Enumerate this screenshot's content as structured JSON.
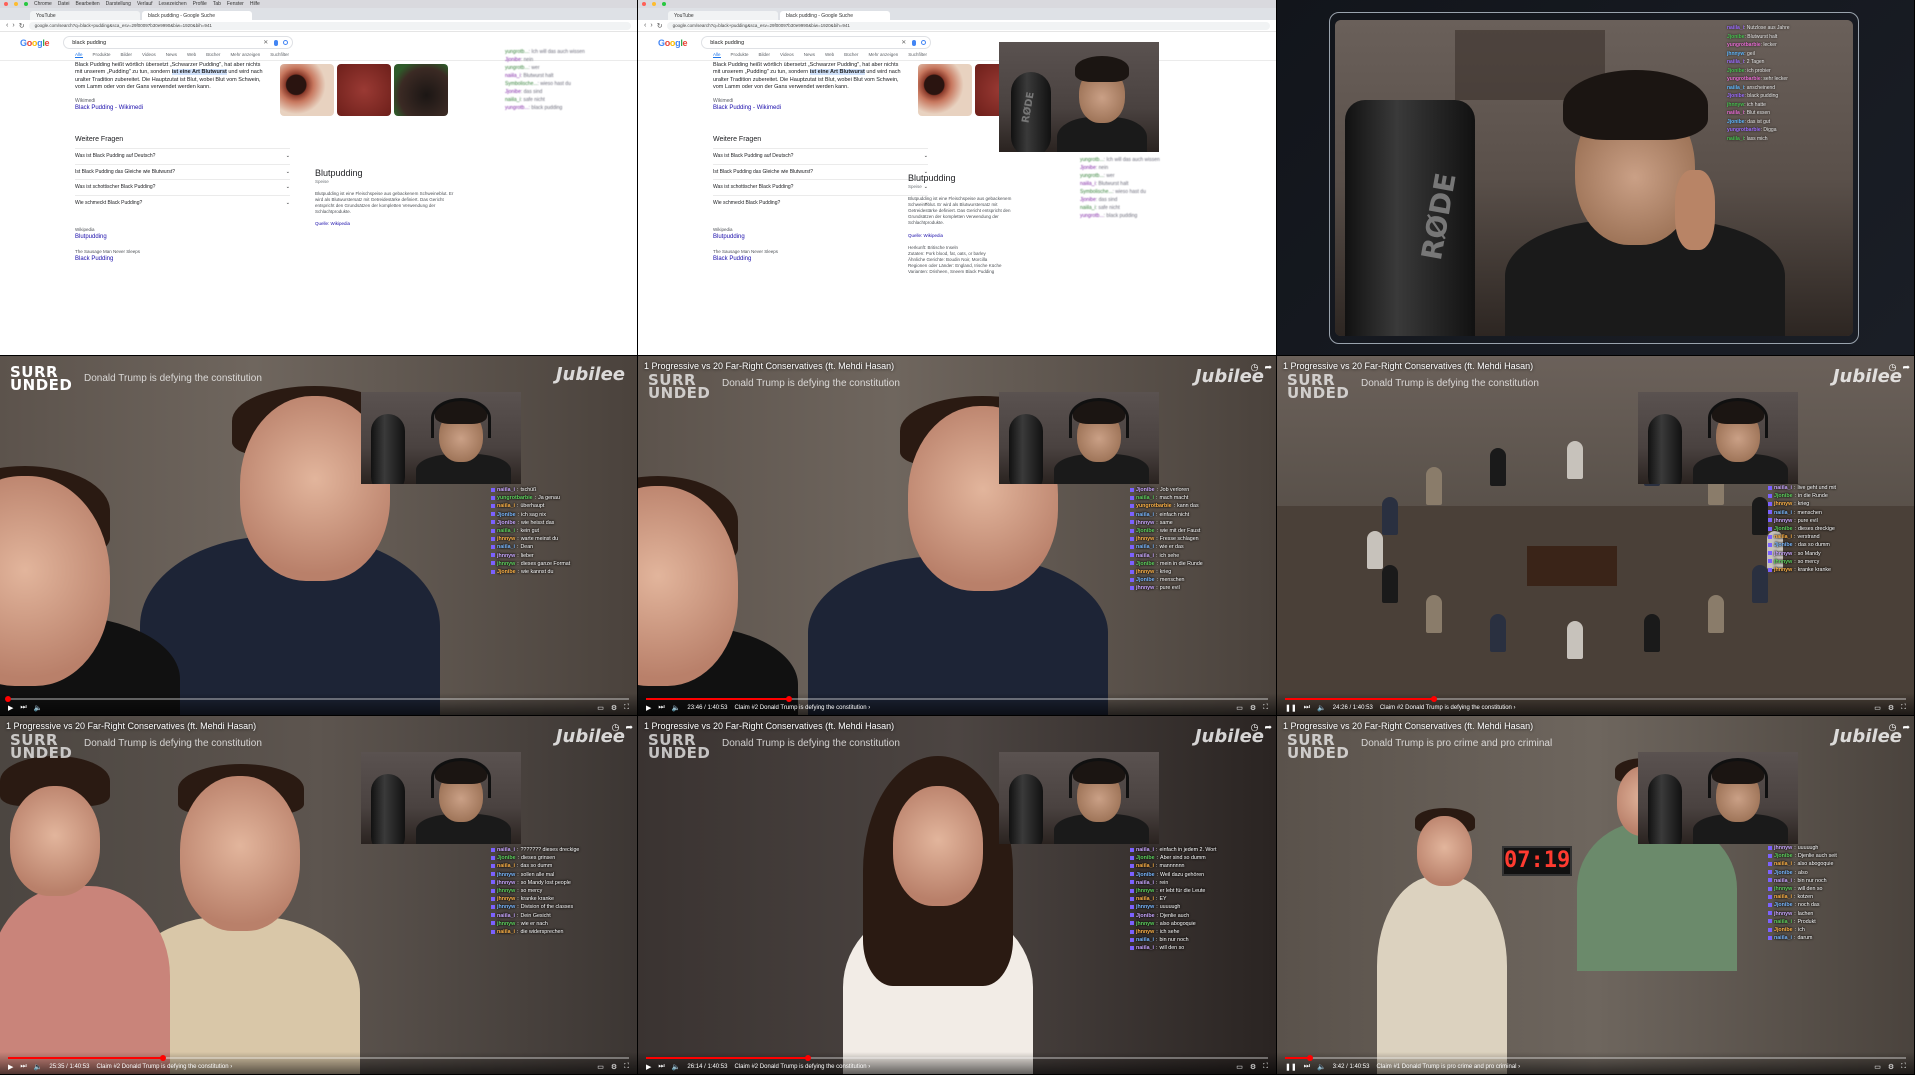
{
  "browser": {
    "mac_menu": [
      "Chrome",
      "Datei",
      "Bearbeiten",
      "Darstellung",
      "Verlauf",
      "Lesezeichen",
      "Profile",
      "Tab",
      "Fenster",
      "Hilfe"
    ],
    "tabs": [
      "YouTube",
      "black pudding - Google Suche"
    ],
    "url": "google.com/search?q=black+pudding&sca_esv=29f00097b30e9990&biw=1920&bih=941",
    "query": "black pudding",
    "search_tabs": [
      "Alle",
      "Produkte",
      "Bilder",
      "Videos",
      "News",
      "Web",
      "Bücher",
      "Mehr anzeigen",
      "Suchfilter"
    ],
    "snippet_pre": "Black Pudding heißt wörtlich übersetzt „Schwarzer Pudding\", hat aber nichts mit unserem „Pudding\" zu tun, sondern ",
    "snippet_bold": "ist eine Art Blutwurst",
    "snippet_post": " und wird nach uralter Tradition zubereitet. Die Hauptzutat ist Blut, wobei Blut vom Schwein, vom Lamm oder von der Gans verwendet werden kann.",
    "source_site": "Wikimedi",
    "source_title": "Black Pudding - Wikimedi",
    "faq_title": "Weitere Fragen",
    "faq": [
      "Was ist Black Pudding auf Deutsch?",
      "Ist Black Pudding das Gleiche wie Blutwurst?",
      "Was ist schottischer Black Pudding?",
      "Wie schmeckt Black Pudding?"
    ],
    "feedback": "Feedback",
    "kp_title": "Blutpudding",
    "kp_sub": "Speise",
    "kp_desc": "Blutpudding ist eine Fleischspeise aus gebackenem Schweineblut. Er wird als Blutwurstersatz mit Getreidestärke definiert. Das Gericht entspricht den Grundsätzen der kompletten Verwendung der Schlachtprodukte.",
    "kp_source": "Quelle: Wikipedia",
    "kp_facts": [
      "Herkunft: Britische Inseln",
      "Zutaten: Pork blood, fat, oats, or barley",
      "Ähnliche Gerichte: Boudin Noir, Morcilla",
      "Regionen oder Länder: England, Irische Küche",
      "Varianten: Drisheen, Sneem Black Pudding"
    ],
    "res2_site": "Wikipedia",
    "res2_title": "Blutpudding",
    "res3_site": "The Sausage Man Never Sleeps",
    "res3_title": "Black Pudding"
  },
  "browser_chat": [
    {
      "name": "yungrotb...",
      "text": "Ich will das auch wissen"
    },
    {
      "name": "Jjonibe",
      "text": "nein"
    },
    {
      "name": "yungrotb...",
      "text": "wer"
    },
    {
      "name": "naiila_i",
      "text": "Blutwurst halt"
    },
    {
      "name": "Symbolische...",
      "text": "wieso hast du"
    },
    {
      "name": "Jjonibe",
      "text": "das sind"
    },
    {
      "name": "naiila_i",
      "text": "safe nicht"
    },
    {
      "name": "yungrotb...",
      "text": "black pudding"
    }
  ],
  "stream_chat": [
    {
      "name": "naiila_i",
      "text": "Nutzlose aus Jahre"
    },
    {
      "name": "Jjonibe",
      "text": "Blutwurst halt"
    },
    {
      "name": "yungrotbarbie",
      "text": "lecker"
    },
    {
      "name": "jhnnyw",
      "text": "geil"
    },
    {
      "name": "naiila_i",
      "text": "2 Tagen"
    },
    {
      "name": "Jjonibe",
      "text": "ich probier"
    },
    {
      "name": "yungrotbarbie",
      "text": "sehr lecker"
    },
    {
      "name": "naiila_i",
      "text": "anscheinend"
    },
    {
      "name": "Jjonibe",
      "text": "black pudding"
    },
    {
      "name": "jhnnyw",
      "text": "ich hatte"
    },
    {
      "name": "naiila_i",
      "text": "Blut essen"
    },
    {
      "name": "Jjonibe",
      "text": "das ist gut"
    },
    {
      "name": "yungrotbarbie",
      "text": "Digga"
    },
    {
      "name": "naiila_i",
      "text": "lass mich"
    }
  ],
  "videos": [
    {
      "title": "",
      "logo": [
        "SURR",
        "UNDED"
      ],
      "subtitle": "Donald Trump is defying the constitution",
      "brand": "Jubilee",
      "time": "",
      "chapter": "",
      "progress": 0.0,
      "chat": [
        {
          "name": "naiila_i",
          "text": "tschüß"
        },
        {
          "name": "yungrotbarbie",
          "text": "Ja genau"
        },
        {
          "name": "naiila_i",
          "text": "überhaupt"
        },
        {
          "name": "Jjonibe",
          "text": "ich sag nix"
        },
        {
          "name": "Jjonibe",
          "text": "wie heisst das"
        },
        {
          "name": "naiila_i",
          "text": "kein gut"
        },
        {
          "name": "jhnnyw",
          "text": "warte meinst du"
        },
        {
          "name": "naiila_i",
          "text": "Dean"
        },
        {
          "name": "jhnnyw",
          "text": "lieber"
        },
        {
          "name": "jhnnyw",
          "text": "dieses ganze Format"
        },
        {
          "name": "Jjonibe",
          "text": "wie kannst du"
        }
      ]
    },
    {
      "title": "1 Progressive vs 20 Far-Right Conservatives (ft. Mehdi Hasan)",
      "logo": [
        "SURR",
        "UNDED"
      ],
      "subtitle": "Donald Trump is defying the constitution",
      "brand": "Jubilee",
      "time": "23:46 / 1:40:53",
      "chapter": "Claim #2 Donald Trump is defying the constitution ›",
      "progress": 0.23,
      "chat": [
        {
          "name": "Jjonibe",
          "text": "Job verloren"
        },
        {
          "name": "naiila_i",
          "text": "mach macht"
        },
        {
          "name": "yungrotbarbie",
          "text": "kann das"
        },
        {
          "name": "naiila_i",
          "text": "einfach nicht"
        },
        {
          "name": "jhnnyw",
          "text": "same"
        },
        {
          "name": "Jjonibe",
          "text": "wie mit der Faust"
        },
        {
          "name": "jhnnyw",
          "text": "Fresse schlagen"
        },
        {
          "name": "naiila_i",
          "text": "wie er das"
        },
        {
          "name": "naiila_i",
          "text": "ich sehe"
        },
        {
          "name": "Jjonibe",
          "text": "mein in die Runde"
        },
        {
          "name": "jhnnyw",
          "text": "krieg"
        },
        {
          "name": "Jjonibe",
          "text": "menschen"
        },
        {
          "name": "jhnnyw",
          "text": "pure evil"
        }
      ]
    },
    {
      "title": "1 Progressive vs 20 Far-Right Conservatives (ft. Mehdi Hasan)",
      "logo": [
        "SURR",
        "UNDED"
      ],
      "subtitle": "Donald Trump is defying the constitution",
      "brand": "Jubilee",
      "time": "24:26 / 1:40:53",
      "chapter": "Claim #2 Donald Trump is defying the constitution ›",
      "progress": 0.24,
      "chat": [
        {
          "name": "naiila_i",
          "text": "live geht und mit"
        },
        {
          "name": "Jjonibe",
          "text": "in die Runde"
        },
        {
          "name": "jhnnyw",
          "text": "krieg"
        },
        {
          "name": "naiila_i",
          "text": "menschen"
        },
        {
          "name": "jhnnyw",
          "text": "pure evil"
        },
        {
          "name": "Jjonibe",
          "text": "dieses dreckige"
        },
        {
          "name": "naiila_i",
          "text": "verstrand"
        },
        {
          "name": "Jjonibe",
          "text": "das so dumm"
        },
        {
          "name": "jhnnyw",
          "text": "so Mandy"
        },
        {
          "name": "jhnnyw",
          "text": "so mercy"
        },
        {
          "name": "jhnnyw",
          "text": "kranke kranke"
        }
      ]
    },
    {
      "title": "1 Progressive vs 20 Far-Right Conservatives (ft. Mehdi Hasan)",
      "logo": [
        "SURR",
        "UNDED"
      ],
      "subtitle": "Donald Trump is defying the constitution",
      "brand": "Jubilee",
      "time": "25:35 / 1:40:53",
      "chapter": "Claim #2 Donald Trump is defying the constitution ›",
      "progress": 0.25,
      "chat": [
        {
          "name": "naiila_i",
          "text": "??????? dieses dreckige"
        },
        {
          "name": "Jjonibe",
          "text": "dieses grinsen"
        },
        {
          "name": "naiila_i",
          "text": "das so dumm"
        },
        {
          "name": "jhnnyw",
          "text": "sollen alle mal"
        },
        {
          "name": "jhnnyw",
          "text": "so Mandy lost people"
        },
        {
          "name": "jhnnyw",
          "text": "so mercy"
        },
        {
          "name": "jhnnyw",
          "text": "kranke kranke"
        },
        {
          "name": "jhnnyw",
          "text": "Division of the classes"
        },
        {
          "name": "naiila_i",
          "text": "Dein Gesicht"
        },
        {
          "name": "jhnnyw",
          "text": "wie er nach"
        },
        {
          "name": "naiila_i",
          "text": "die widersprechen"
        }
      ]
    },
    {
      "title": "1 Progressive vs 20 Far-Right Conservatives (ft. Mehdi Hasan)",
      "logo": [
        "SURR",
        "UNDED"
      ],
      "subtitle": "Donald Trump is defying the constitution",
      "brand": "Jubilee",
      "time": "26:14 / 1:40:53",
      "chapter": "Claim #2 Donald Trump is defying the constitution ›",
      "progress": 0.26,
      "chat": [
        {
          "name": "naiila_i",
          "text": "einfach in jedem 2. Wort"
        },
        {
          "name": "Jjonibe",
          "text": "Aber sind so dumm"
        },
        {
          "name": "naiila_i",
          "text": "mannnnnn"
        },
        {
          "name": "Jjonibe",
          "text": "Weil dazu gehören"
        },
        {
          "name": "naiila_i",
          "text": "rein"
        },
        {
          "name": "jhnnyw",
          "text": "er lebt für die Leute"
        },
        {
          "name": "naiila_i",
          "text": "EY"
        },
        {
          "name": "jhnnyw",
          "text": "uuuuugh"
        },
        {
          "name": "Jjonibe",
          "text": "Djenlie auch"
        },
        {
          "name": "jhnnyw",
          "text": "also abogoquie"
        },
        {
          "name": "jhnnyw",
          "text": "ich sehe"
        },
        {
          "name": "naiila_i",
          "text": "bin nur noch"
        },
        {
          "name": "naiila_i",
          "text": "will den so"
        }
      ]
    },
    {
      "title": "1 Progressive vs 20 Far-Right Conservatives (ft. Mehdi Hasan)",
      "logo": [
        "SURR",
        "UNDED"
      ],
      "subtitle": "Donald Trump is pro crime and pro criminal",
      "brand": "Jubilee",
      "time": "3:42 / 1:40:53",
      "chapter": "Claim #1 Donald Trump is pro crime and pro criminal ›",
      "progress": 0.04,
      "clock": "07:19",
      "chat": [
        {
          "name": "jhnnyw",
          "text": "uuuuugh"
        },
        {
          "name": "Jjonibe",
          "text": "Djenlie auch seit"
        },
        {
          "name": "naiila_i",
          "text": "also abogoquie"
        },
        {
          "name": "Jjonibe",
          "text": "also"
        },
        {
          "name": "naiila_i",
          "text": "bin nur noch"
        },
        {
          "name": "jhnnyw",
          "text": "will den so"
        },
        {
          "name": "naiila_i",
          "text": "kotzen"
        },
        {
          "name": "Jjonibe",
          "text": "noch das"
        },
        {
          "name": "jhnnyw",
          "text": "lachen"
        },
        {
          "name": "naiila_i",
          "text": "Produkt"
        },
        {
          "name": "Jjonibe",
          "text": "ich"
        },
        {
          "name": "naiila_i",
          "text": "darum"
        }
      ]
    }
  ],
  "colors": {
    "youtube_red": "#ff0000",
    "google_blue": "#1a73e8",
    "chat_name": "#c9a7ff"
  }
}
